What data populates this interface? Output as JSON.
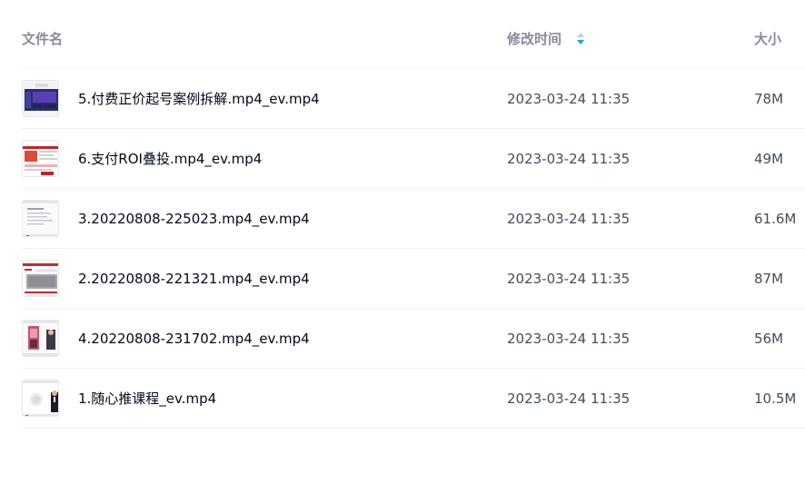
{
  "header": {
    "name_label": "文件名",
    "time_label": "修改时间",
    "size_label": "大小",
    "sort_icon": "sort-icon"
  },
  "files": [
    {
      "name": "5.付费正价起号案例拆解.mp4_ev.mp4",
      "modified": "2023-03-24 11:35",
      "size": "78M"
    },
    {
      "name": "6.支付ROI叠投.mp4_ev.mp4",
      "modified": "2023-03-24 11:35",
      "size": "49M"
    },
    {
      "name": "3.20220808-225023.mp4_ev.mp4",
      "modified": "2023-03-24 11:35",
      "size": "61.6M"
    },
    {
      "name": "2.20220808-221321.mp4_ev.mp4",
      "modified": "2023-03-24 11:35",
      "size": "87M"
    },
    {
      "name": "4.20220808-231702.mp4_ev.mp4",
      "modified": "2023-03-24 11:35",
      "size": "56M"
    },
    {
      "name": "1.随心推课程_ev.mp4",
      "modified": "2023-03-24 11:35",
      "size": "10.5M"
    }
  ],
  "colors": {
    "header_text": "#878c9c",
    "name_text": "#03081a",
    "meta_text": "#454d5a",
    "sort_active": "#06a7ff",
    "divider": "#f1f2f4"
  }
}
